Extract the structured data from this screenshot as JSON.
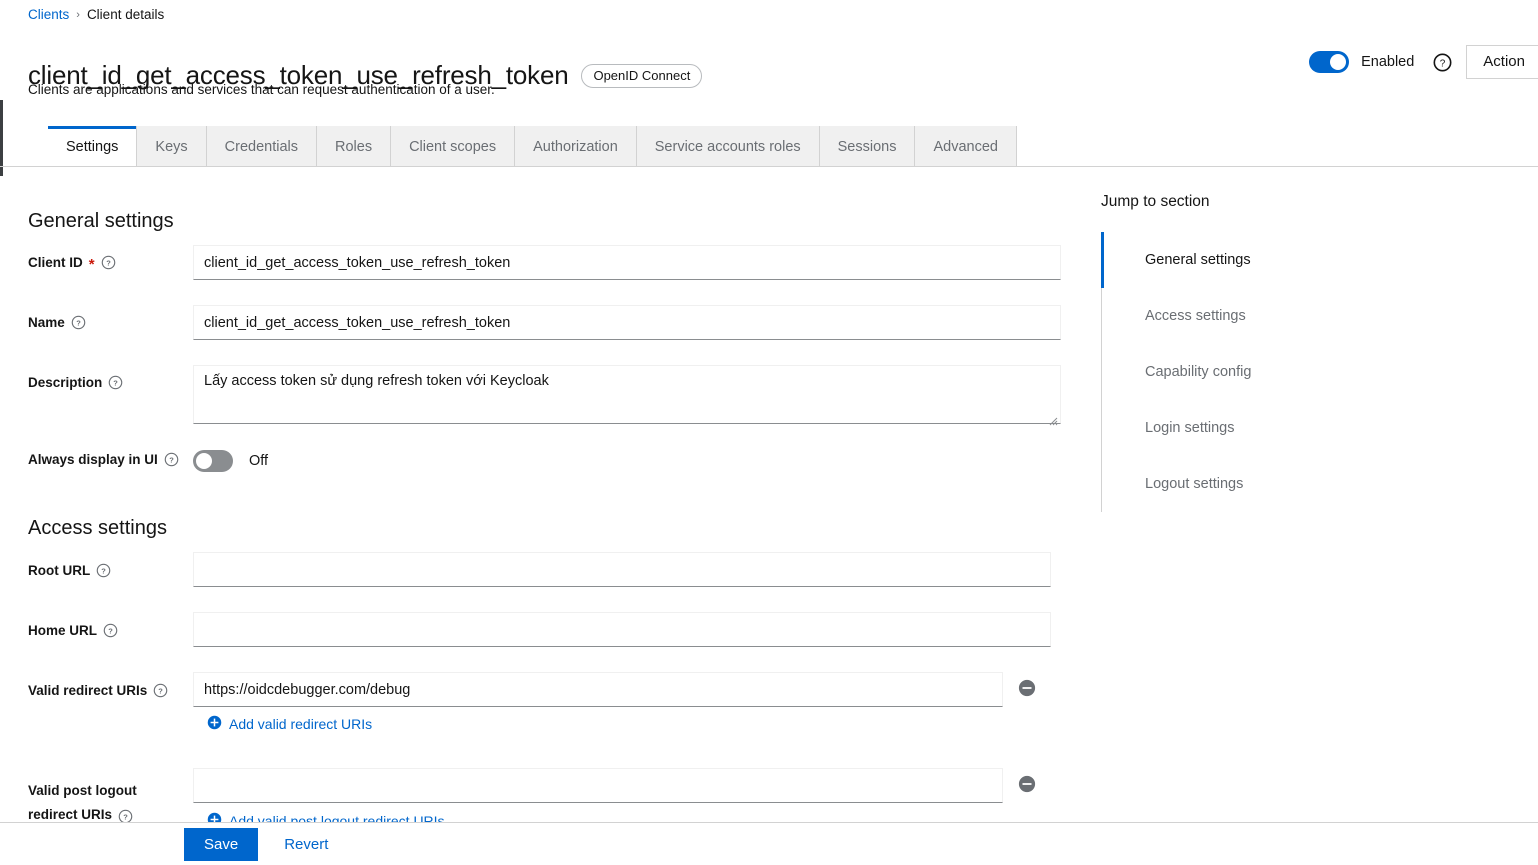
{
  "breadcrumb": {
    "root": "Clients",
    "separator": "›",
    "current": "Client details"
  },
  "header": {
    "title": "client_id_get_access_token_use_refresh_token",
    "protocol_badge": "OpenID Connect",
    "subtitle": "Clients are applications and services that can request authentication of a user.",
    "enabled_label": "Enabled",
    "enabled_state": "on",
    "action_button": "Action",
    "help_icon": "help-circle-icon"
  },
  "tabs": [
    {
      "label": "Settings",
      "active": true
    },
    {
      "label": "Keys",
      "active": false
    },
    {
      "label": "Credentials",
      "active": false
    },
    {
      "label": "Roles",
      "active": false
    },
    {
      "label": "Client scopes",
      "active": false
    },
    {
      "label": "Authorization",
      "active": false
    },
    {
      "label": "Service accounts roles",
      "active": false
    },
    {
      "label": "Sessions",
      "active": false
    },
    {
      "label": "Advanced",
      "active": false
    }
  ],
  "general_settings": {
    "title": "General settings",
    "client_id": {
      "label": "Client ID",
      "required": "*",
      "value": "client_id_get_access_token_use_refresh_token"
    },
    "name": {
      "label": "Name",
      "value": "client_id_get_access_token_use_refresh_token"
    },
    "description": {
      "label": "Description",
      "value": "Lấy access token sử dụng refresh token với Keycloak"
    },
    "always_display": {
      "label": "Always display in UI",
      "state": "off",
      "state_label": "Off"
    }
  },
  "access_settings": {
    "title": "Access settings",
    "root_url": {
      "label": "Root URL",
      "value": ""
    },
    "home_url": {
      "label": "Home URL",
      "value": ""
    },
    "valid_redirect_uris": {
      "label": "Valid redirect URIs",
      "value": "https://oidcdebugger.com/debug",
      "add_label": "Add valid redirect URIs",
      "remove_icon": "minus-circle-icon"
    },
    "valid_post_logout_redirect_uris": {
      "label_line1": "Valid post logout",
      "label_line2": "redirect URIs",
      "value": "",
      "remove_icon": "minus-circle-icon"
    }
  },
  "jump_to_section": {
    "title": "Jump to section",
    "items": [
      {
        "label": "General settings",
        "active": true
      },
      {
        "label": "Access settings",
        "active": false
      },
      {
        "label": "Capability config",
        "active": false
      },
      {
        "label": "Login settings",
        "active": false
      },
      {
        "label": "Logout settings",
        "active": false
      }
    ]
  },
  "footer": {
    "save": "Save",
    "revert": "Revert"
  },
  "colors": {
    "accent": "#0066cc",
    "required": "#c9190b",
    "muted": "#6a6e73",
    "border": "#d2d2d2",
    "toggle_off": "#8a8d90"
  }
}
